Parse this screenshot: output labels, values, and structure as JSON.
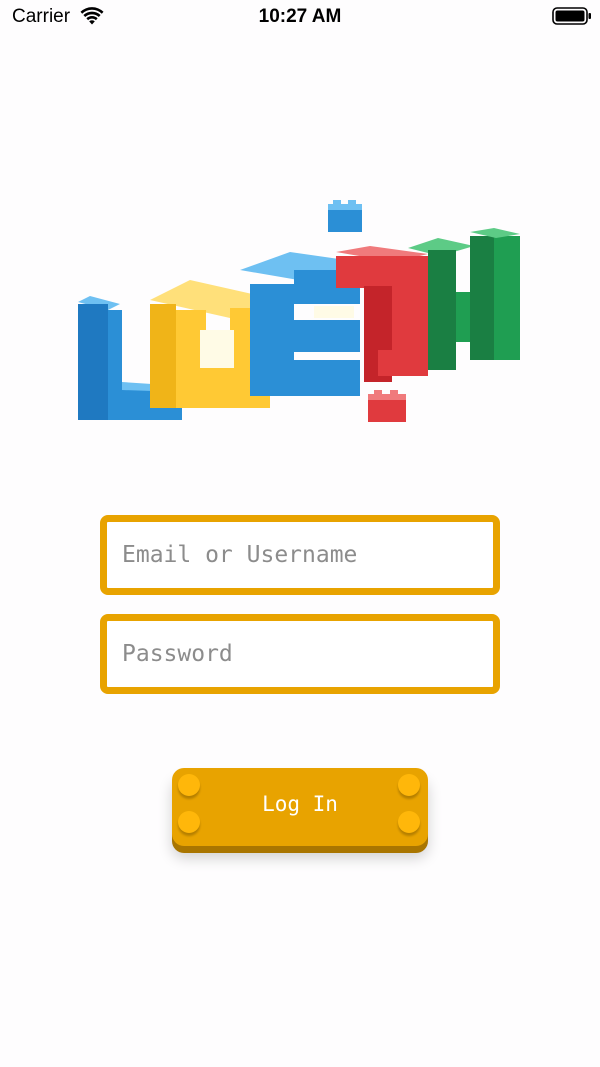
{
  "status_bar": {
    "carrier": "Carrier",
    "time": "10:27 AM",
    "wifi_icon": "wifi-icon",
    "battery_icon": "battery-icon"
  },
  "logo": {
    "text": "LOGIN",
    "colors": {
      "blue": "#2b8fd6",
      "yellow": "#ffc934",
      "red": "#e03a3e",
      "green": "#1f9e52"
    }
  },
  "form": {
    "email_placeholder": "Email or Username",
    "email_value": "",
    "password_placeholder": "Password",
    "password_value": ""
  },
  "login_button": {
    "label": "Log In"
  },
  "colors": {
    "accent": "#e8a300",
    "accent_dark": "#a97500",
    "stud": "#ffb70a",
    "background": "#fefdfe"
  }
}
